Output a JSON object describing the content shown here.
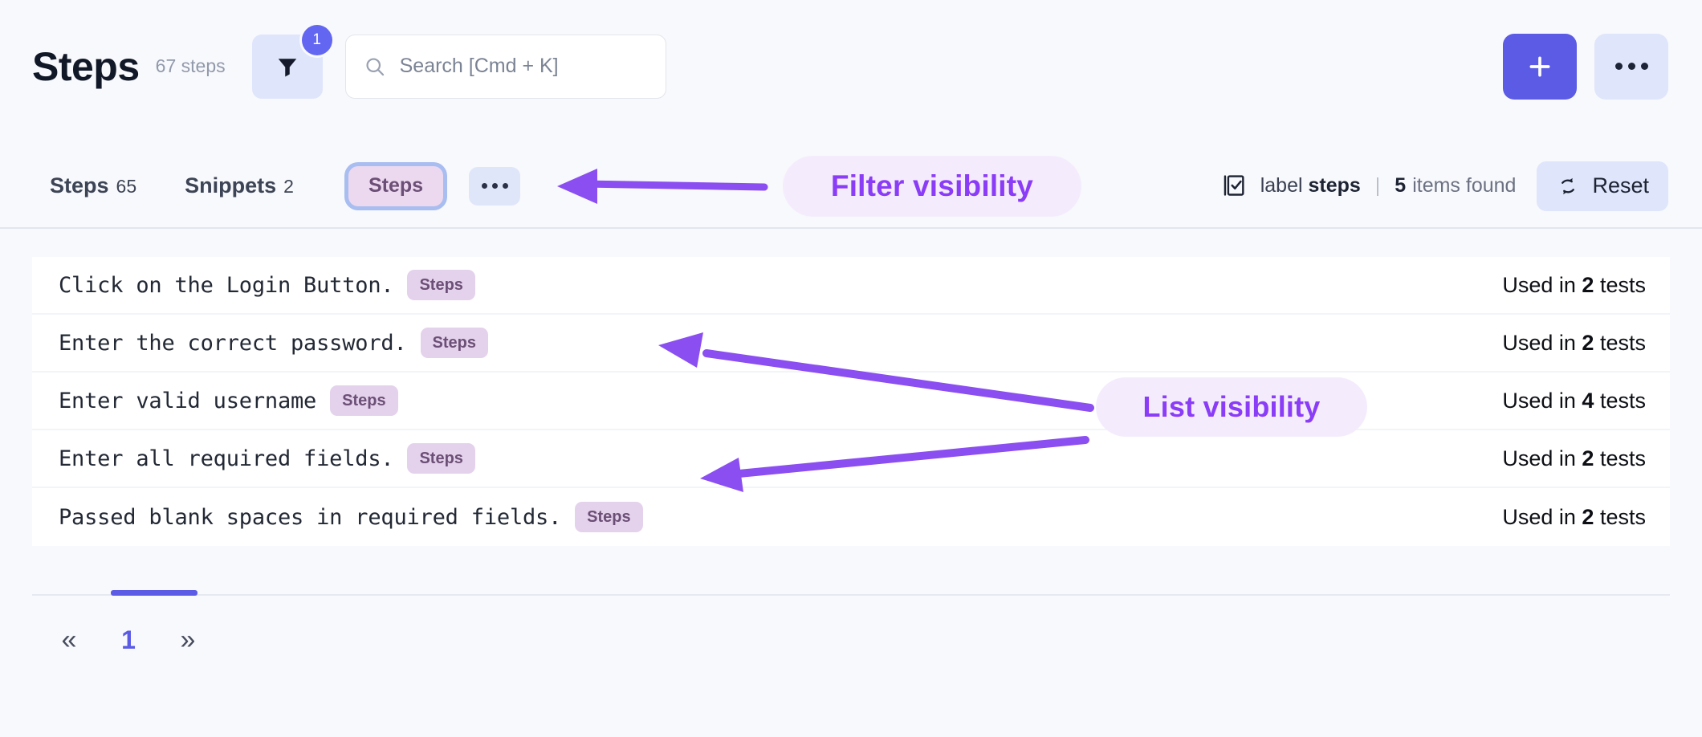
{
  "header": {
    "title": "Steps",
    "count_label": "67 steps",
    "filter_icon": "funnel-icon",
    "filter_badge": "1",
    "search": {
      "icon": "search-icon",
      "placeholder": "Search [Cmd + K]",
      "value": ""
    },
    "add_label": "+",
    "more_label": "•••"
  },
  "filterbar": {
    "tabs": [
      {
        "label": "Steps",
        "count": "65",
        "active": true
      },
      {
        "label": "Snippets",
        "count": "2",
        "active": false
      }
    ],
    "chips": [
      {
        "label": "Steps",
        "selected": true
      }
    ],
    "chip_more_label": "•••",
    "label_icon": "checklist-icon",
    "label_prefix": "label",
    "label_value": "steps",
    "separator": "|",
    "found_count": "5",
    "found_text": "items found",
    "reset_icon": "refresh-icon",
    "reset_label": "Reset"
  },
  "list": {
    "rows": [
      {
        "text": "Click on the Login Button.",
        "badge": "Steps",
        "used_prefix": "Used in",
        "used_count": "2",
        "used_suffix": "tests"
      },
      {
        "text": "Enter the correct password.",
        "badge": "Steps",
        "used_prefix": "Used in",
        "used_count": "2",
        "used_suffix": "tests"
      },
      {
        "text": "Enter valid username",
        "badge": "Steps",
        "used_prefix": "Used in",
        "used_count": "4",
        "used_suffix": "tests"
      },
      {
        "text": "Enter all required fields.",
        "badge": "Steps",
        "used_prefix": "Used in",
        "used_count": "2",
        "used_suffix": "tests"
      },
      {
        "text": "Passed blank spaces in required fields.",
        "badge": "Steps",
        "used_prefix": "Used in",
        "used_count": "2",
        "used_suffix": "tests"
      }
    ]
  },
  "pagination": {
    "prev_label": "«",
    "next_label": "»",
    "pages": [
      "1"
    ],
    "active_page": "1"
  },
  "annotations": [
    {
      "id": "anno-filter",
      "text": "Filter visibility"
    },
    {
      "id": "anno-list",
      "text": "List visibility"
    }
  ],
  "colors": {
    "accent": "#5b5be6",
    "annotation": "#8b3cf7",
    "badge_bg": "#e4d2ec",
    "badge_text": "#6c4f76",
    "chip_ring": "#a8bdf0",
    "soft_button_bg": "#dfe5fb",
    "page_bg": "#f8f9fc",
    "row_bg": "#ffffff"
  }
}
